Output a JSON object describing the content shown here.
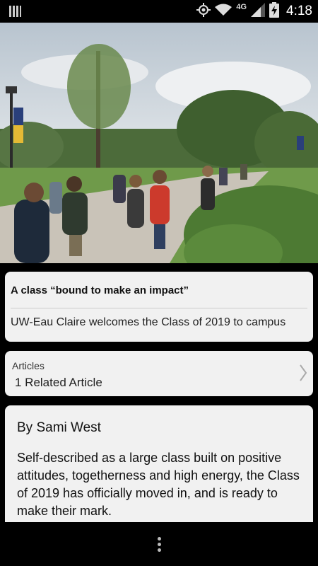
{
  "status_bar": {
    "time": "4:18",
    "network": "4G",
    "icons": [
      "notification-icon",
      "gps-icon",
      "wifi-icon",
      "signal-icon",
      "battery-charging-icon"
    ]
  },
  "article": {
    "title": "A class “bound to make an impact”",
    "subtitle": "UW-Eau Claire welcomes the Class of 2019 to campus",
    "related": {
      "label": "Articles",
      "count_text": "1 Related Article"
    },
    "byline": "By Sami West",
    "body": "Self-described as a large class built on positive attitudes, togetherness and high energy, the Class of 2019 has officially moved in, and is ready to make their mark."
  },
  "bottom_bar": {
    "overflow_icon": "overflow-menu-icon"
  }
}
